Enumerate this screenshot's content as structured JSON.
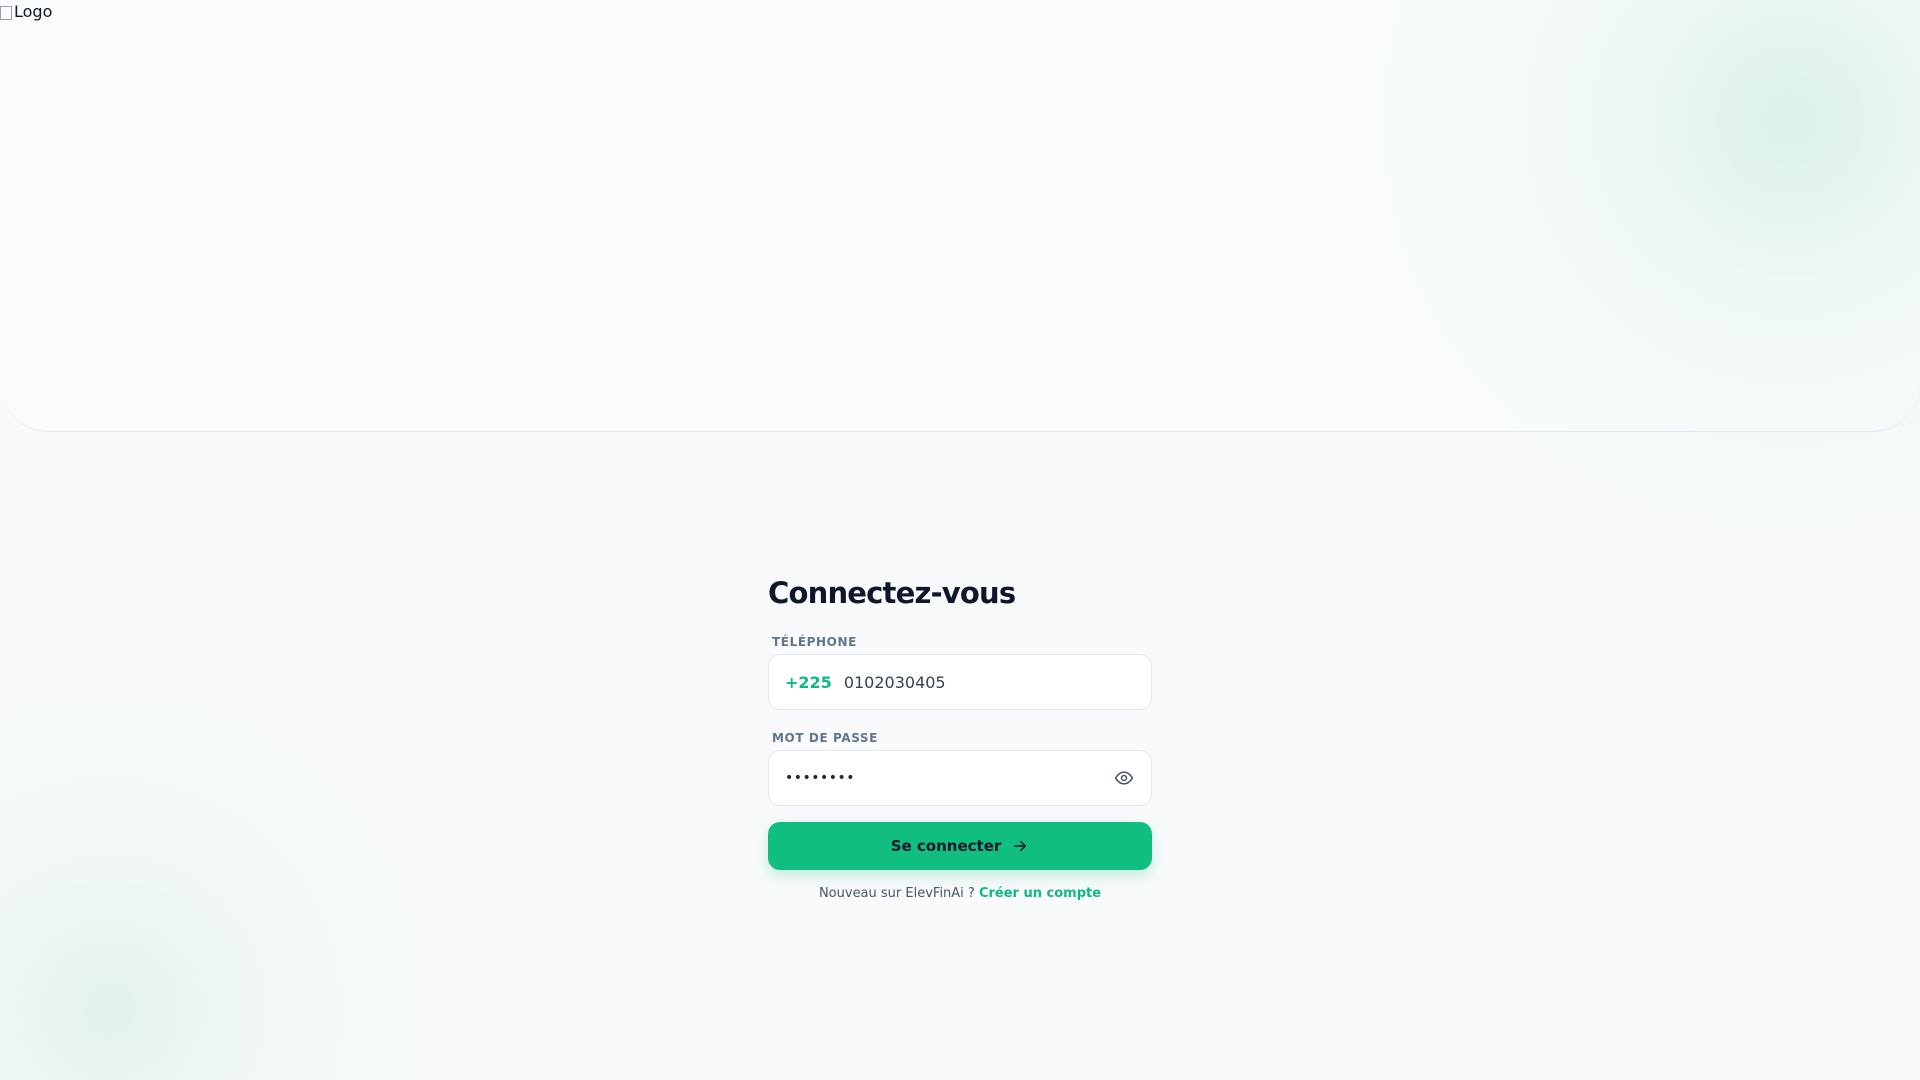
{
  "header": {
    "logo_alt": "Logo"
  },
  "login": {
    "title": "Connectez-vous",
    "phone": {
      "label": "TÉLÉPHONE",
      "country_code": "+225",
      "value": "0102030405"
    },
    "password": {
      "label": "MOT DE PASSE",
      "masked_value": "••••••••",
      "toggle_icon": "eye-icon"
    },
    "submit": {
      "label": "Se connecter",
      "icon": "arrow-right-icon"
    },
    "signup": {
      "prompt": "Nouveau sur ElevFinAi ?",
      "link": "Créer un compte"
    }
  },
  "colors": {
    "accent": "#10bf7f",
    "accent_text": "#10b981",
    "title": "#0f172a",
    "label": "#64748b",
    "background": "#f8fafc"
  }
}
